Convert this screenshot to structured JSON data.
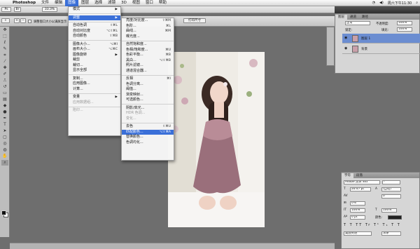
{
  "menubar": {
    "app": "Photoshop",
    "items": [
      "文件",
      "编辑",
      "图像",
      "图层",
      "选择",
      "滤镜",
      "3D",
      "视图",
      "窗口",
      "帮助"
    ],
    "active_index": 2,
    "right": {
      "date_time": "周六下午11:30"
    }
  },
  "options": {
    "zoom": "33.3",
    "resize_windows_label": "调整窗口大小以满屏显示",
    "print_size": "打印尺寸"
  },
  "image_menu": {
    "items": [
      {
        "label": "模式",
        "shortcut": "",
        "submenu": true,
        "disabled": false
      },
      {
        "label": "调整",
        "shortcut": "",
        "submenu": true,
        "disabled": false,
        "highlight": true
      },
      {
        "label": "自动色调",
        "shortcut": "⇧⌘L",
        "disabled": false
      },
      {
        "label": "自动对比度",
        "shortcut": "⌥⇧⌘L",
        "disabled": false
      },
      {
        "label": "自动颜色",
        "shortcut": "⇧⌘B",
        "disabled": false
      },
      {
        "label": "图像大小...",
        "shortcut": "⌥⌘I",
        "disabled": false
      },
      {
        "label": "画布大小...",
        "shortcut": "⌥⌘C",
        "disabled": false
      },
      {
        "label": "图像旋转",
        "shortcut": "",
        "submenu": true,
        "disabled": false
      },
      {
        "label": "裁剪",
        "shortcut": "",
        "disabled": false
      },
      {
        "label": "裁切...",
        "shortcut": "",
        "disabled": false
      },
      {
        "label": "显示全部",
        "shortcut": "",
        "disabled": false
      },
      {
        "label": "复制...",
        "shortcut": "",
        "disabled": false
      },
      {
        "label": "应用图像...",
        "shortcut": "",
        "disabled": false
      },
      {
        "label": "计算...",
        "shortcut": "",
        "disabled": false
      },
      {
        "label": "变量",
        "shortcut": "",
        "submenu": true,
        "disabled": false
      },
      {
        "label": "应用数据组...",
        "shortcut": "",
        "disabled": true
      },
      {
        "label": "陷印...",
        "shortcut": "",
        "disabled": true
      }
    ]
  },
  "adjust_menu": {
    "items": [
      {
        "label": "亮度/对比度...",
        "shortcut": "⇧⌘M"
      },
      {
        "label": "色阶...",
        "shortcut": "⌘L"
      },
      {
        "label": "曲线...",
        "shortcut": "⌘M"
      },
      {
        "label": "曝光度...",
        "shortcut": ""
      },
      {
        "label": "自然饱和度...",
        "shortcut": ""
      },
      {
        "label": "色相/饱和度...",
        "shortcut": "⌘U"
      },
      {
        "label": "色彩平衡...",
        "shortcut": "⌘B"
      },
      {
        "label": "黑白...",
        "shortcut": "⌥⇧⌘B"
      },
      {
        "label": "照片滤镜...",
        "shortcut": ""
      },
      {
        "label": "通道混合器...",
        "shortcut": ""
      },
      {
        "label": "反相",
        "shortcut": "⌘I"
      },
      {
        "label": "色调分离...",
        "shortcut": ""
      },
      {
        "label": "阈值...",
        "shortcut": ""
      },
      {
        "label": "渐变映射...",
        "shortcut": ""
      },
      {
        "label": "可选颜色...",
        "shortcut": ""
      },
      {
        "label": "阴影/高光...",
        "shortcut": ""
      },
      {
        "label": "HDR 色调...",
        "shortcut": "",
        "disabled": true
      },
      {
        "label": "变化...",
        "shortcut": "",
        "disabled": true
      },
      {
        "label": "去色",
        "shortcut": "⇧⌘U"
      },
      {
        "label": "匹配颜色...",
        "shortcut": "⌥⇧⌘A",
        "highlight": true
      },
      {
        "label": "替换颜色...",
        "shortcut": ""
      },
      {
        "label": "色调均化...",
        "shortcut": ""
      }
    ]
  },
  "layers_panel": {
    "tabs": [
      "图层",
      "通道",
      "路径"
    ],
    "blend_mode": "正常",
    "opacity_label": "不透明度:",
    "opacity": "100%",
    "lock_label": "锁定:",
    "fill_label": "填充:",
    "fill": "100%",
    "layers": [
      {
        "name": "图层 1",
        "selected": true
      },
      {
        "name": "背景",
        "selected": false
      }
    ]
  },
  "char_panel": {
    "tabs": [
      "字符",
      "段落"
    ],
    "font": "Adobe 黑体 Std",
    "style": "-",
    "size": "26.47 pt",
    "leading": "(自动)",
    "tracking": "0",
    "kerning": "0%",
    "scale_v": "100%",
    "scale_h": "100%",
    "baseline": "0 pt",
    "color_label": "颜色:",
    "lang": "美国英语",
    "aa": "浑厚"
  },
  "colors": {
    "accent": "#3a6fd8",
    "panel": "#d6d6d6"
  }
}
